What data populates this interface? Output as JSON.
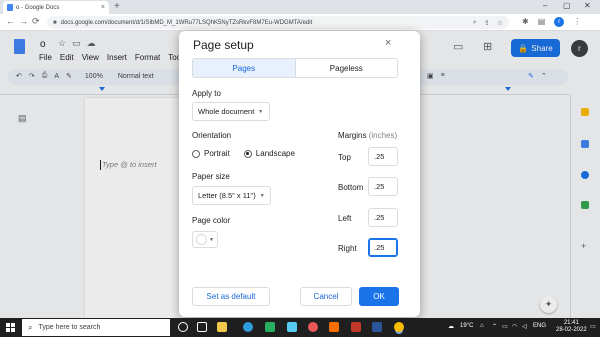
{
  "browser": {
    "tab_title": "o - Google Docs",
    "tab_close": "×",
    "new_tab": "+",
    "url": "docs.google.com/document/d/1iSIbMD_M_1WRu77LSQhK5NyTZsRkvF8M7Eu-WDGMTA/edit",
    "back": "←",
    "forward": "→",
    "reload": "⟳",
    "lock": "🔒"
  },
  "docs": {
    "title": "o",
    "menu": [
      "File",
      "Edit",
      "View",
      "Insert",
      "Format",
      "Too"
    ],
    "share_label": "Share",
    "user_initial": "r",
    "zoom": "100%",
    "style": "Normal text",
    "page_hint": "Type @ to insert"
  },
  "dialog": {
    "title": "Page setup",
    "close": "×",
    "tabs": [
      {
        "label": "Pages",
        "active": true
      },
      {
        "label": "Pageless",
        "active": false
      }
    ],
    "apply_to_label": "Apply to",
    "apply_to_value": "Whole document",
    "orientation_label": "Orientation",
    "orientation_options": [
      {
        "label": "Portrait",
        "selected": false
      },
      {
        "label": "Landscape",
        "selected": true
      }
    ],
    "paper_size_label": "Paper size",
    "paper_size_value": "Letter (8.5\" x 11\")",
    "page_color_label": "Page color",
    "page_color_value": "#ffffff",
    "margins_label": "Margins",
    "margins_unit": "(inches)",
    "margins": [
      {
        "label": "Top",
        "value": ".25"
      },
      {
        "label": "Bottom",
        "value": ".25"
      },
      {
        "label": "Left",
        "value": ".25"
      },
      {
        "label": "Right",
        "value": ".25"
      }
    ],
    "set_default_label": "Set as default",
    "cancel_label": "Cancel",
    "ok_label": "OK"
  },
  "taskbar": {
    "search_placeholder": "Type here to search",
    "weather": "19°C",
    "language": "ENG",
    "time": "21:41",
    "date": "28-02-2022"
  },
  "colors": {
    "accent": "#1a73e8",
    "tab_active_bg": "#e8f0fe"
  }
}
